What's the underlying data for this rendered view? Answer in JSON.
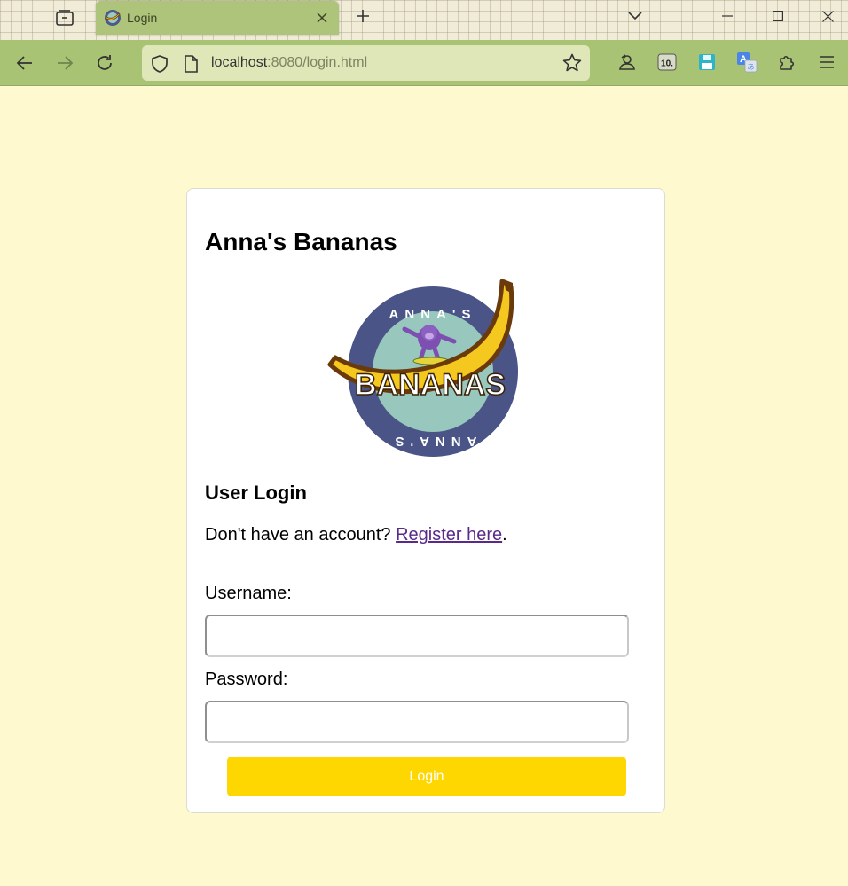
{
  "browser": {
    "tab": {
      "title": "Login"
    },
    "url": {
      "host": "localhost",
      "rest": ":8080/login.html"
    },
    "icons": {
      "overview": "tab-overview-icon",
      "close": "close-icon",
      "new_tab": "plus-icon",
      "list_tabs": "chevron-down-icon",
      "minimize": "minimize-icon",
      "maximize": "maximize-icon",
      "close_window": "close-window-icon",
      "back": "arrow-left-icon",
      "forward": "arrow-right-icon",
      "reload": "reload-icon",
      "shield": "shield-icon",
      "page": "page-icon",
      "bookmark": "star-icon",
      "extensions": [
        "profile-icon",
        "10-badge-icon",
        "save-icon",
        "translate-icon",
        "puzzle-icon",
        "menu-icon"
      ]
    },
    "colors": {
      "tabstrip": "#f1ecd8",
      "navbar": "#a9c375",
      "urlbar": "#dfe6b7"
    }
  },
  "page": {
    "title": "Anna's Bananas",
    "logo": {
      "top_text": "ANNA'S",
      "main_text": "BANANAS",
      "bottom_text": "ANNA'S"
    },
    "section_title": "User Login",
    "register": {
      "prefix": "Don't have an account? ",
      "link": "Register here",
      "suffix": "."
    },
    "username": {
      "label": "Username:",
      "value": ""
    },
    "password": {
      "label": "Password:",
      "value": ""
    },
    "login_button": "Login",
    "colors": {
      "background": "#fff9d0",
      "button": "#ffd700",
      "link": "#5a2a8a"
    }
  }
}
